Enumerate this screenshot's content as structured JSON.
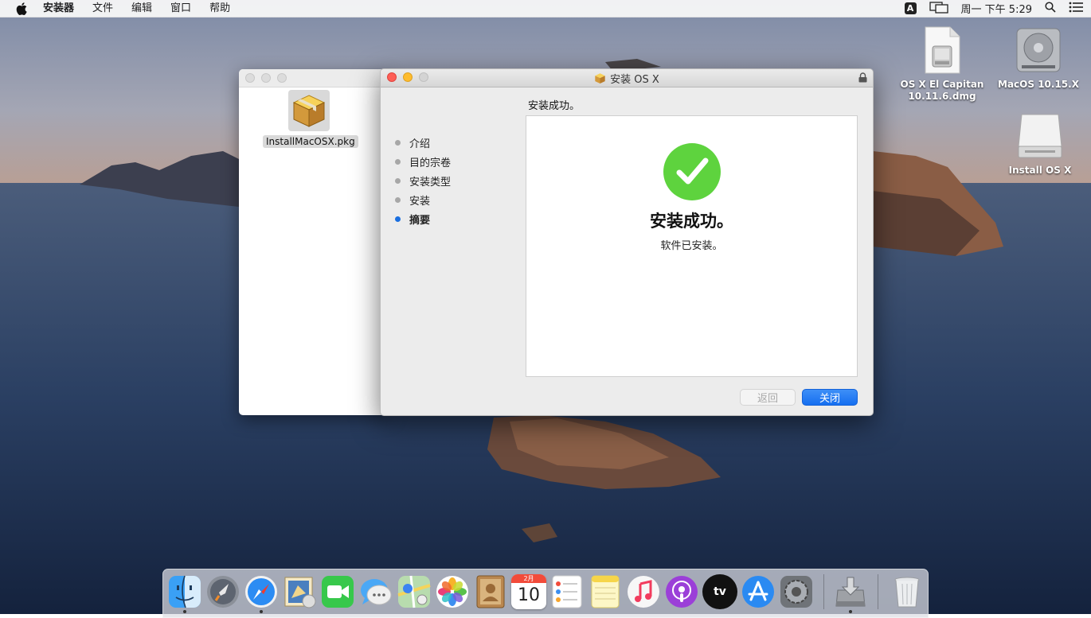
{
  "menubar": {
    "app_name": "安装器",
    "menus": [
      "文件",
      "编辑",
      "窗口",
      "帮助"
    ],
    "input_source": "A",
    "clock": "周一 下午 5:29"
  },
  "desktop": {
    "items": [
      {
        "label": "OS X El Capitan 10.11.6.dmg",
        "icon": "dmg-file-icon"
      },
      {
        "label": "MacOS 10.15.X",
        "icon": "hard-drive-icon"
      },
      {
        "label": "Install OS X",
        "icon": "external-drive-icon"
      }
    ]
  },
  "finder": {
    "file_label": "InstallMacOSX.pkg"
  },
  "installer": {
    "title": "安装 OS X",
    "step_heading": "安装成功。",
    "steps": [
      {
        "label": "介绍",
        "active": false
      },
      {
        "label": "目的宗卷",
        "active": false
      },
      {
        "label": "安装类型",
        "active": false
      },
      {
        "label": "安装",
        "active": false
      },
      {
        "label": "摘要",
        "active": true
      }
    ],
    "success_title": "安装成功。",
    "success_subtitle": "软件已安装。",
    "back_label": "返回",
    "close_label": "关闭",
    "accent_color": "#1a6fe0",
    "success_color": "#5ed33e"
  },
  "dock": {
    "apps": [
      {
        "icon": "finder-icon",
        "running": true
      },
      {
        "icon": "launchpad-icon",
        "running": false
      },
      {
        "icon": "safari-icon",
        "running": true
      },
      {
        "icon": "mail-icon",
        "running": false
      },
      {
        "icon": "facetime-icon",
        "running": false
      },
      {
        "icon": "messages-icon",
        "running": false
      },
      {
        "icon": "maps-icon",
        "running": false
      },
      {
        "icon": "photos-icon",
        "running": false
      },
      {
        "icon": "contacts-icon",
        "running": false
      },
      {
        "icon": "calendar-icon",
        "running": false,
        "month": "2月",
        "day": "10"
      },
      {
        "icon": "reminders-icon",
        "running": false
      },
      {
        "icon": "notes-icon",
        "running": false
      },
      {
        "icon": "music-icon",
        "running": false
      },
      {
        "icon": "podcasts-icon",
        "running": false
      },
      {
        "icon": "tv-icon",
        "running": false,
        "text": "tv"
      },
      {
        "icon": "app-store-icon",
        "running": false
      },
      {
        "icon": "system-preferences-icon",
        "running": false
      },
      {
        "icon": "installer-icon",
        "running": true
      },
      {
        "icon": "trash-icon",
        "running": false
      }
    ]
  }
}
